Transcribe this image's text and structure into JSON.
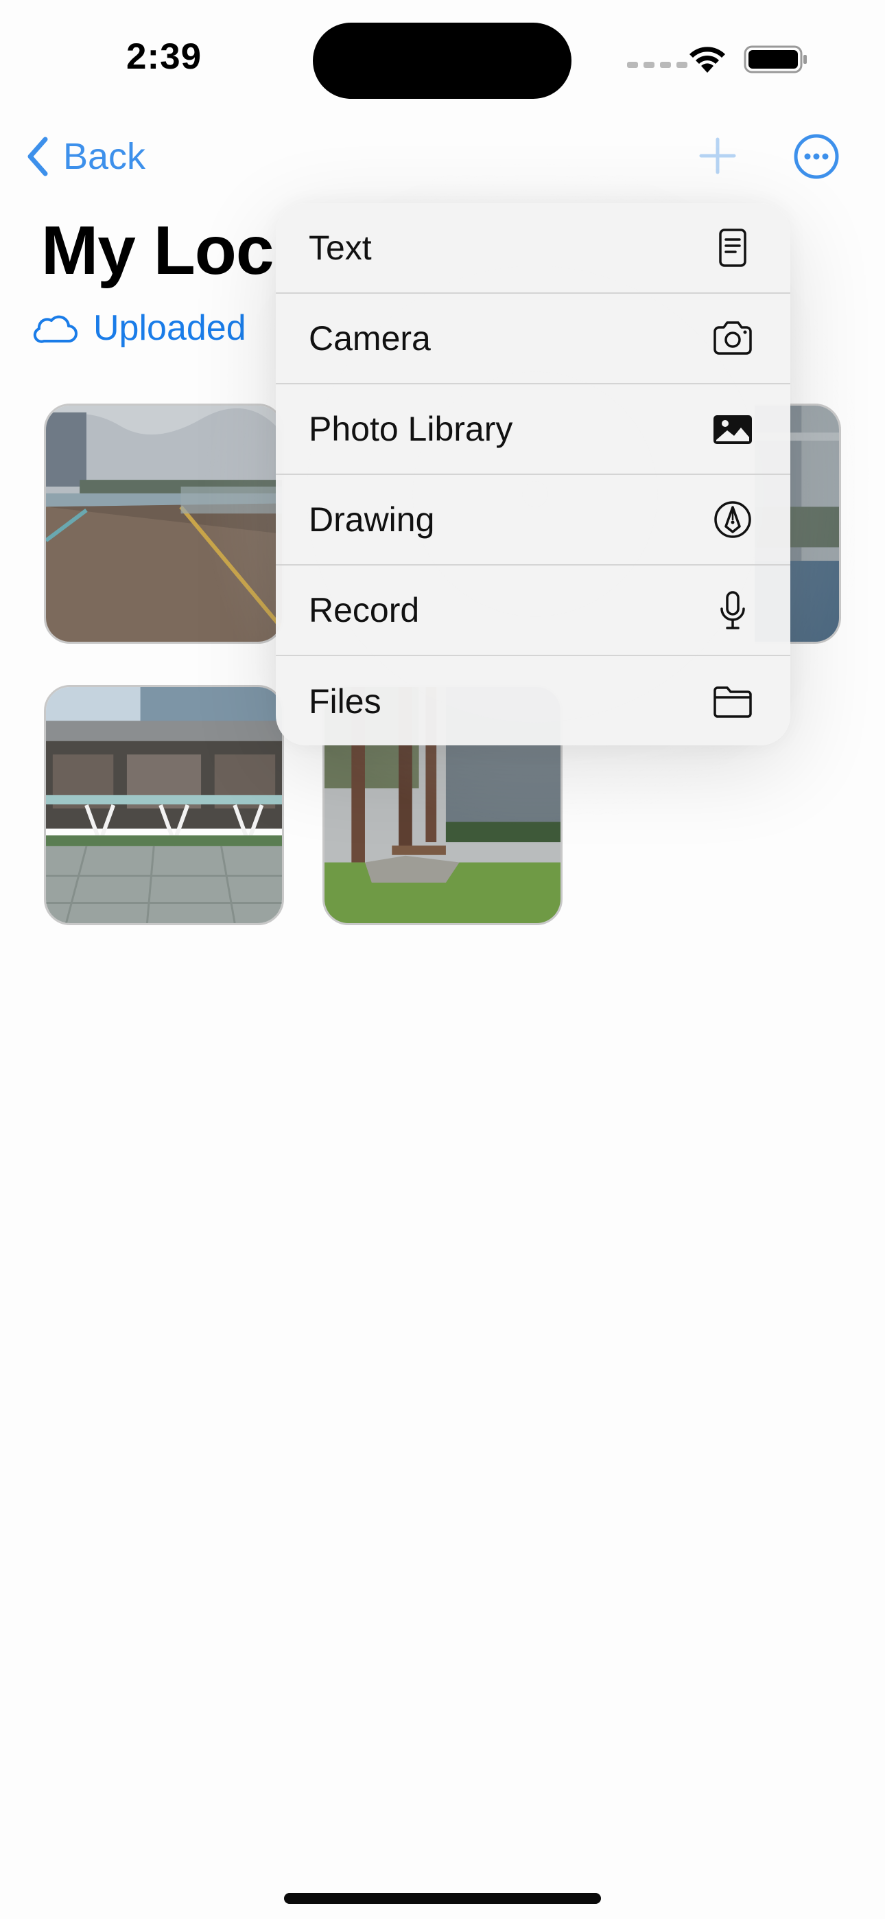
{
  "status_bar": {
    "time": "2:39"
  },
  "nav": {
    "back_label": "Back"
  },
  "page": {
    "title": "My Loc",
    "status": "Uploaded"
  },
  "colors": {
    "accent": "#1a7ce8",
    "menu_background": "#f3f3f3"
  },
  "photos": [
    {
      "name": "harbour-promenade"
    },
    {
      "name": "building-partial"
    },
    {
      "name": "building-plaza"
    },
    {
      "name": "garden-bench"
    }
  ],
  "menu": {
    "items": [
      {
        "label": "Text",
        "icon": "text-document-icon"
      },
      {
        "label": "Camera",
        "icon": "camera-icon"
      },
      {
        "label": "Photo Library",
        "icon": "photo-icon"
      },
      {
        "label": "Drawing",
        "icon": "pen-tip-icon"
      },
      {
        "label": "Record",
        "icon": "microphone-icon"
      },
      {
        "label": "Files",
        "icon": "folder-icon"
      }
    ]
  }
}
